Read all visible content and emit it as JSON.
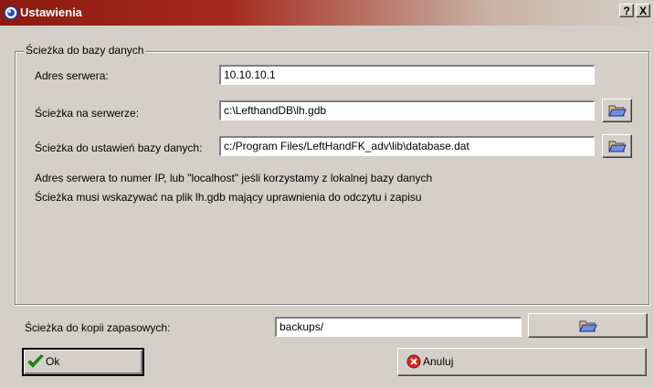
{
  "window": {
    "title": "Ustawienia",
    "help_button": "?",
    "close_button": "X"
  },
  "group": {
    "title": "Ścieżka do bazy danych",
    "server_address_label": "Adres serwera:",
    "server_address_value": "10.10.10.1",
    "server_path_label": "Ścieżka na serwerze:",
    "server_path_value": "c:\\LefthandDB\\lh.gdb",
    "db_settings_label": "Ścieżka do ustawień bazy danych:",
    "db_settings_value": "c:/Program Files/LeftHandFK_adv\\lib\\database.dat",
    "info_line1": "Adres serwera to numer IP, lub \"localhost\" jeśli korzystamy z lokalnej bazy danych",
    "info_line2": "Ścieżka musi wskazywać na plik lh.gdb mający uprawnienia do odczytu i zapisu"
  },
  "backup": {
    "label": "Ścieżka do kopii zapasowych:",
    "value": "backups/"
  },
  "buttons": {
    "ok_label": "Ok",
    "cancel_label": "Anuluj"
  },
  "icons": {
    "app": "app-icon",
    "folder": "folder-open-icon",
    "ok": "checkmark-icon",
    "cancel": "cancel-icon"
  }
}
